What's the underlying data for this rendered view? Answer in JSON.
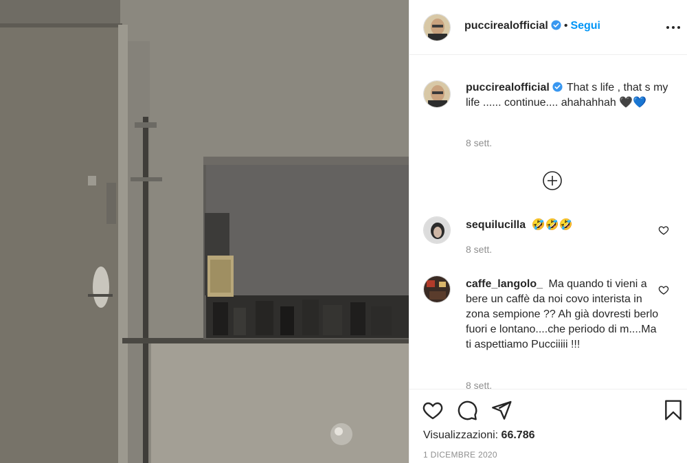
{
  "post": {
    "author": "puccirealofficial",
    "follow_label": "Segui",
    "separator": "•",
    "caption": "That s life , that s my life ...... continue.... ahahahhah 🖤💙",
    "caption_time": "8 sett."
  },
  "comments": [
    {
      "username": "sequilucilla",
      "text": "🤣🤣🤣",
      "time": "8 sett."
    },
    {
      "username": "caffe_langolo_",
      "text": "Ma quando ti vieni a bere un caffè da noi covo interista in zona sempione ?? Ah già dovresti berlo fuori e lontano....che periodo di m....Ma ti aspettiamo Pucciiiii !!!",
      "time": "8 sett."
    }
  ],
  "stats": {
    "views_label": "Visualizzazioni:",
    "views_count": "66.786",
    "date": "1 DICEMBRE 2020"
  },
  "colors": {
    "accent": "#0095f6",
    "verified": "#3897f0",
    "muted": "#8e8e8e",
    "text": "#262626"
  },
  "icons": {
    "verified": "verified-badge-icon",
    "more": "more-options-icon",
    "load_more": "plus-circle-icon",
    "like": "heart-icon",
    "comment": "comment-icon",
    "share": "share-icon",
    "save": "bookmark-icon"
  }
}
